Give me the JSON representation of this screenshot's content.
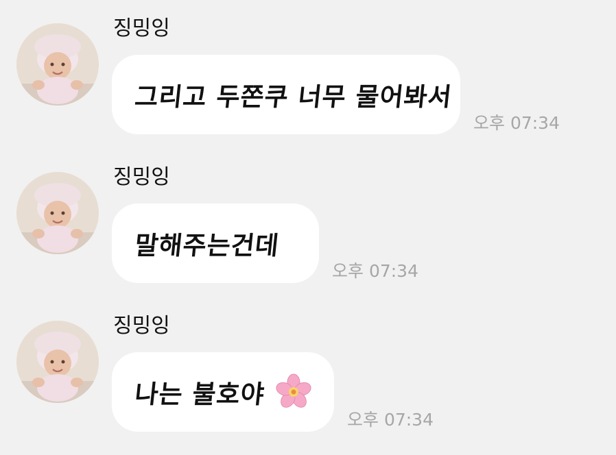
{
  "messages": [
    {
      "sender": "징밍잉",
      "text": "그리고 두쫀쿠 너무 물어봐서",
      "time": "오후 07:34",
      "avatar_icon": "baby-profile-photo",
      "emoji": ""
    },
    {
      "sender": "징밍잉",
      "text": "말해주는건데",
      "time": "오후 07:34",
      "avatar_icon": "baby-profile-photo",
      "emoji": ""
    },
    {
      "sender": "징밍잉",
      "text": "나는 불호야",
      "time": "오후 07:34",
      "avatar_icon": "baby-profile-photo",
      "emoji": "cherry-blossom"
    }
  ],
  "colors": {
    "background": "#f1f1f1",
    "bubble": "#ffffff",
    "time_text": "#a6a6a6",
    "emoji_petal": "#f6a9c7"
  }
}
